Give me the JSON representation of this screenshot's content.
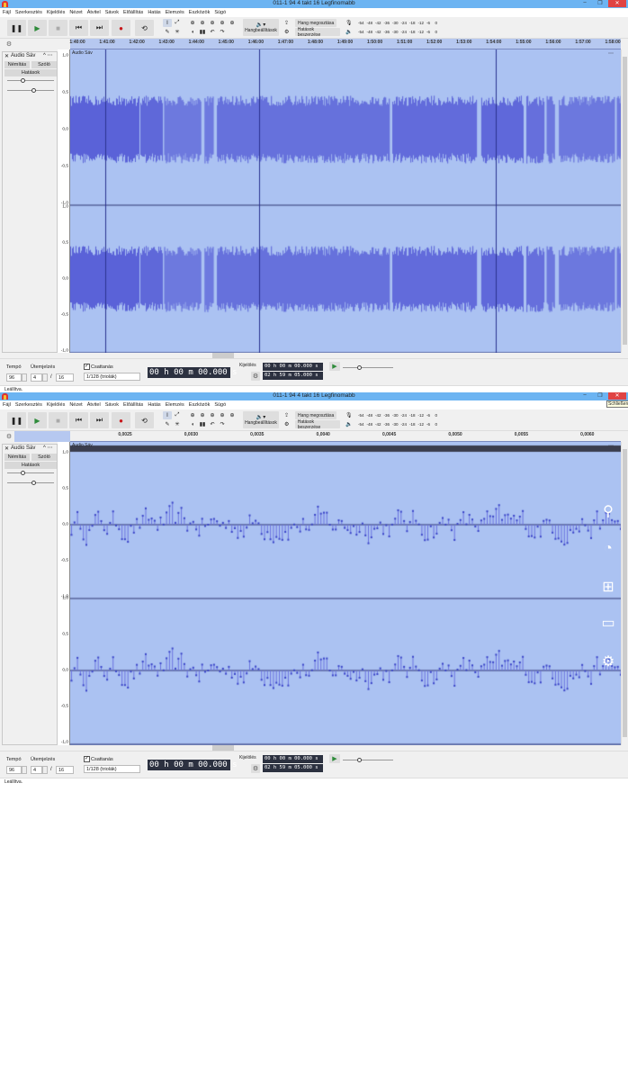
{
  "window": {
    "title": "011-1 94 4 takt 16 Legfinomabb",
    "minimize": "–",
    "maximize": "❐",
    "close": "✕",
    "close_tooltip": "Schließen"
  },
  "menu": [
    "Fájl",
    "Szerkesztés",
    "Kijelölés",
    "Nézet",
    "Átvitel",
    "Sávok",
    "Előállítás",
    "Hatás",
    "Elemzés",
    "Eszközök",
    "Súgó"
  ],
  "toolbar": {
    "audio_settings": "Hangbeállítások",
    "share_audio": "Hang megosztása",
    "manage_effects": "Hatások beszerzése",
    "meter_ticks": [
      "-54",
      "-48",
      "-42",
      "-36",
      "-30",
      "-24",
      "-18",
      "-12",
      "-6",
      "0"
    ]
  },
  "rulers": [
    [
      "1:40:00",
      "1:41:00",
      "1:42:00",
      "1:43:00",
      "1:44:00",
      "1:45:00",
      "1:46:00",
      "1:47:00",
      "1:48:00",
      "1:49:00",
      "1:50:00",
      "1:51:00",
      "1:52:00",
      "1:53:00",
      "1:54:00",
      "1:55:00",
      "1:56:00",
      "1:57:00",
      "1:58:00"
    ],
    [
      "0,0025",
      "0,0030",
      "0,0035",
      "0,0040",
      "0,0045",
      "0,0050",
      "0,0055",
      "0,0060"
    ]
  ],
  "track": {
    "name": "Audio Sáv",
    "clip_name": "Audio Sáv",
    "mute": "Némítás",
    "solo": "Szóló",
    "effects": "Hatások",
    "scale": [
      "1,0",
      "0,5",
      "0,0",
      "-0,5",
      "-1,0"
    ]
  },
  "bottom": {
    "tempo_label": "Tempó",
    "tempo": "96",
    "time_sig_label": "Ütemjelzés",
    "time_sig_num": "4",
    "time_sig_sep": "/",
    "time_sig_den": "16",
    "snap_label": "Csattanás",
    "snap_checked": true,
    "snap_value": "1/128 (triolák)",
    "time": "00 h 00 m 00.000 s",
    "selection_label": "Kijelölés",
    "sel_start": "00 h 00 m 00.000 s",
    "sel_end": "02 h 59 m 05.000 s"
  },
  "status": "Leállítva.",
  "colors": {
    "wave": "#5a62d8",
    "wave_bg": "#abc2f2",
    "title_bar": "#6cb4f2"
  },
  "charms": [
    "search-icon",
    "share-icon",
    "windows-start-icon",
    "devices-icon",
    "settings-icon"
  ]
}
